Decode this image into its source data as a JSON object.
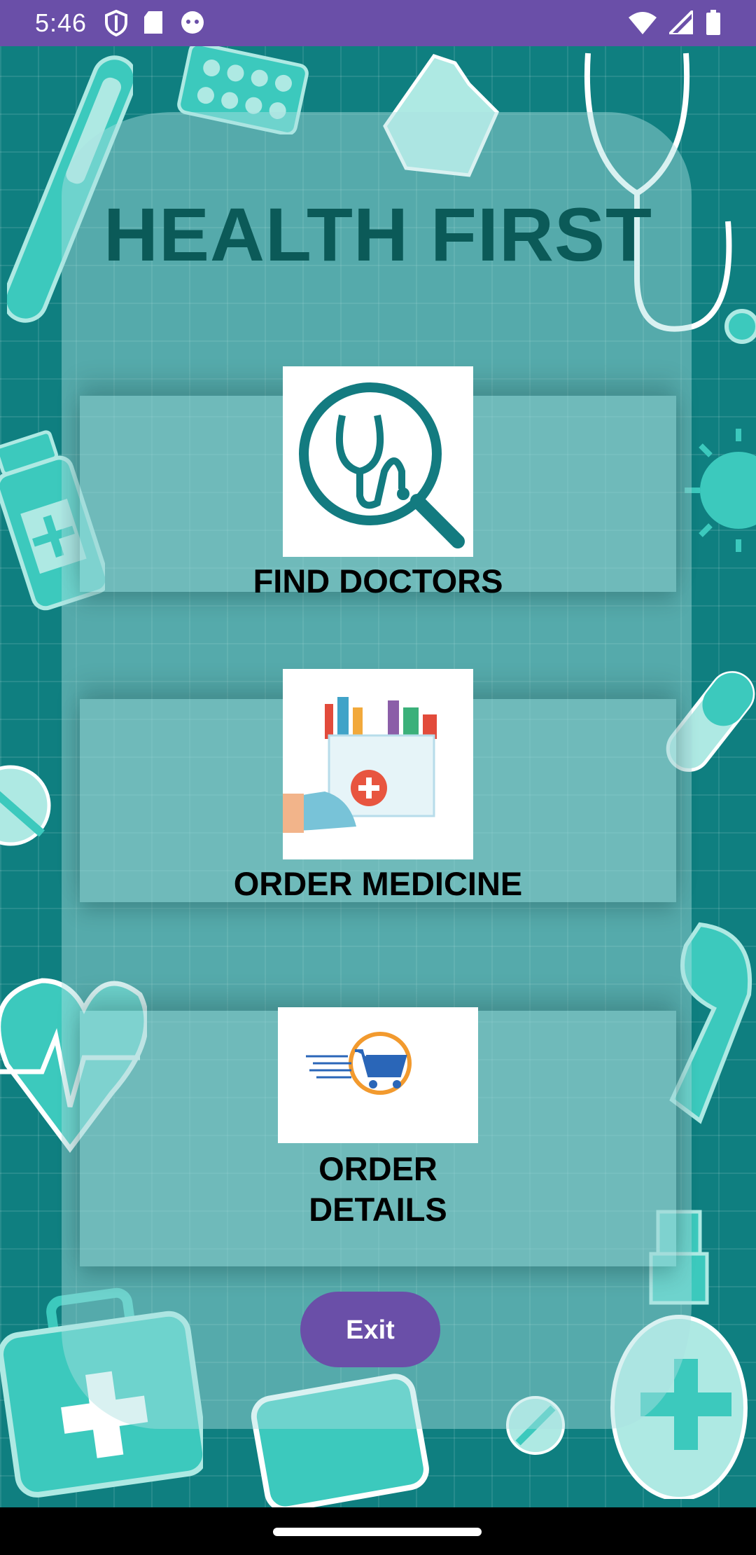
{
  "status_bar": {
    "time": "5:46",
    "icons": [
      "shield-icon",
      "sd-card-icon",
      "android-debug-icon",
      "wifi-icon",
      "signal-icon",
      "battery-icon"
    ]
  },
  "app": {
    "title": "HEALTH FIRST"
  },
  "menu": {
    "find_doctors": {
      "label": "FIND DOCTORS",
      "icon": "stethoscope-search-icon"
    },
    "order_medicine": {
      "label": "ORDER MEDICINE",
      "icon": "medicine-bag-icon"
    },
    "order_details": {
      "label_line1": "ORDER",
      "label_line2": "DETAILS",
      "icon": "shopping-cart-icon"
    }
  },
  "exit_button": {
    "label": "Exit"
  },
  "colors": {
    "background": "#0f7f80",
    "accent": "#6a4fa8",
    "title": "#0b5a58",
    "decoration": "#3cc9bd"
  }
}
